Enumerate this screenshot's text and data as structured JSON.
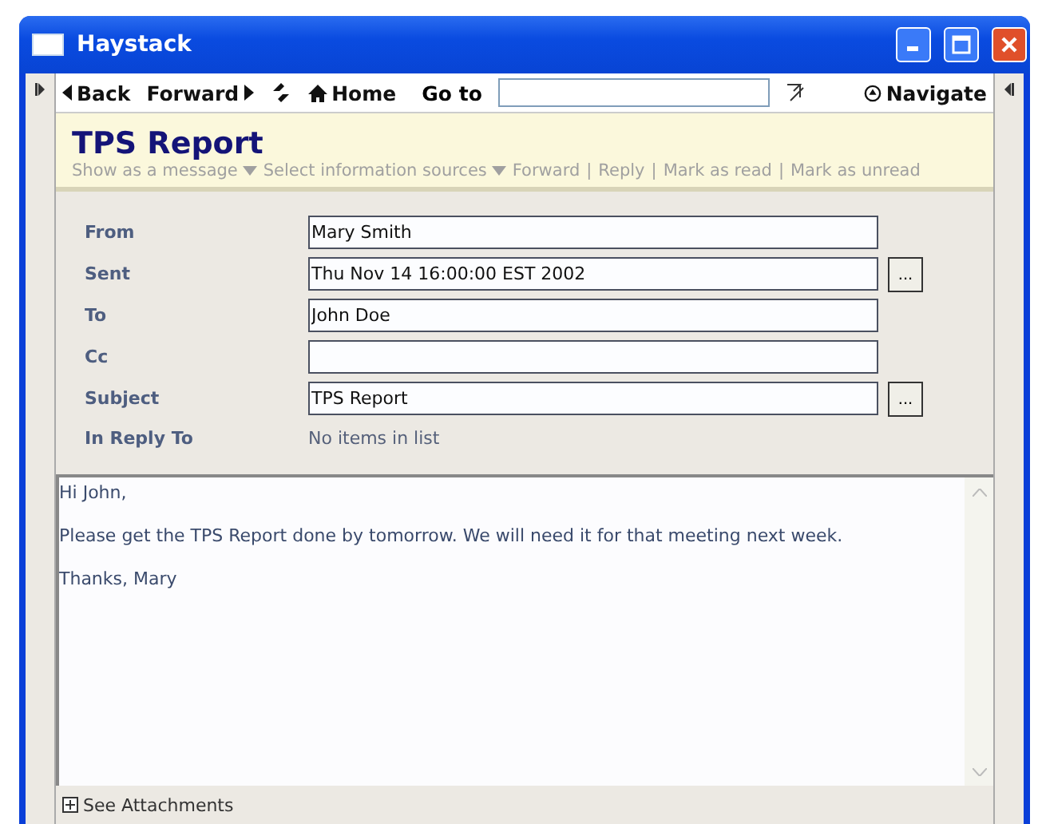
{
  "window": {
    "title": "Haystack"
  },
  "toolbar": {
    "back": "Back",
    "forward": "Forward",
    "home": "Home",
    "goto_label": "Go to",
    "navigate": "Navigate"
  },
  "header": {
    "title": "TPS Report",
    "separator": "|",
    "actions": [
      {
        "label": "Show as a message",
        "kind": "dropdown"
      },
      {
        "label": "Select information sources",
        "kind": "dropdown"
      },
      {
        "label": "Forward",
        "kind": "link"
      },
      {
        "label": "Reply",
        "kind": "link"
      },
      {
        "label": "Mark as read",
        "kind": "link"
      },
      {
        "label": "Mark as unread",
        "kind": "link"
      }
    ]
  },
  "fields": [
    {
      "label": "From",
      "kind": "text",
      "value": "Mary Smith"
    },
    {
      "label": "Sent",
      "kind": "text",
      "value": "Thu Nov 14 16:00:00 EST 2002",
      "button": "..."
    },
    {
      "label": "To",
      "kind": "text",
      "value": "John Doe"
    },
    {
      "label": "Cc",
      "kind": "text"
    },
    {
      "label": "Subject",
      "kind": "text",
      "value": "TPS Report",
      "button": "..."
    },
    {
      "label": "In Reply To",
      "kind": "list",
      "value": "No items in list"
    }
  ],
  "body": {
    "paragraphs": [
      "Hi John,",
      "Please get the TPS Report done by tomorrow. We will need it for that meeting next week.",
      "Thanks, Mary"
    ]
  },
  "attachments": {
    "label": "See Attachments",
    "expanded": false
  }
}
